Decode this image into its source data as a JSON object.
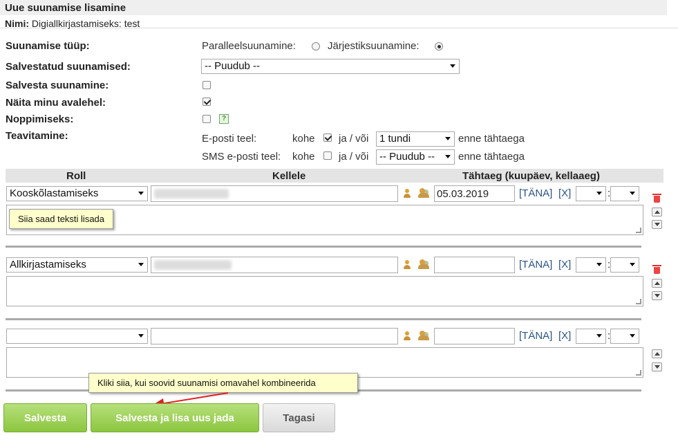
{
  "title": "Uue suunamise lisamine",
  "name_label": "Nimi:",
  "name_value": "Digiallkirjastamiseks: test",
  "fields": {
    "type_label": "Suunamise tüüp:",
    "parallel_label": "Paralleelsuunamine:",
    "sequential_label": "Järjestiksuunamine:",
    "saved_label": "Salvestatud suunamised:",
    "saved_value": "-- Puudub --",
    "save_routing_label": "Salvesta suunamine:",
    "show_home_label": "Näita minu avalehel:",
    "noppimiseks_label": "Noppimiseks:",
    "help_glyph": "?",
    "notify_label": "Teavitamine:"
  },
  "notify": {
    "email_label": "E-posti teel:",
    "sms_label": "SMS e-posti teel:",
    "kohe": "kohe",
    "and_or": "ja / või",
    "email_time": "1 tundi",
    "sms_time": "-- Puudub --",
    "before_deadline": "enne tähtaega"
  },
  "table": {
    "col_role": "Roll",
    "col_to": "Kellele",
    "col_deadline": "Tähtaeg (kuupäev, kellaaeg)",
    "today_link": "[TÄNA]",
    "clear_link": "[X]",
    "colon": ":",
    "rows": [
      {
        "role": "Kooskõlastamiseks",
        "date": "05.03.2019"
      },
      {
        "role": "Allkirjastamiseks",
        "date": ""
      },
      {
        "role": "",
        "date": ""
      }
    ]
  },
  "tooltips": {
    "text_hint": "Siia saad teksti lisada",
    "combine_hint": "Kliki siia, kui soovid suunamisi omavahel kombineerida"
  },
  "buttons": {
    "save": "Salvesta",
    "save_add": "Salvesta ja lisa uus jada",
    "back": "Tagasi"
  },
  "colors": {
    "accent_green": "#8cc63f",
    "link_blue": "#2a5585",
    "arrow_red": "#e02020"
  }
}
